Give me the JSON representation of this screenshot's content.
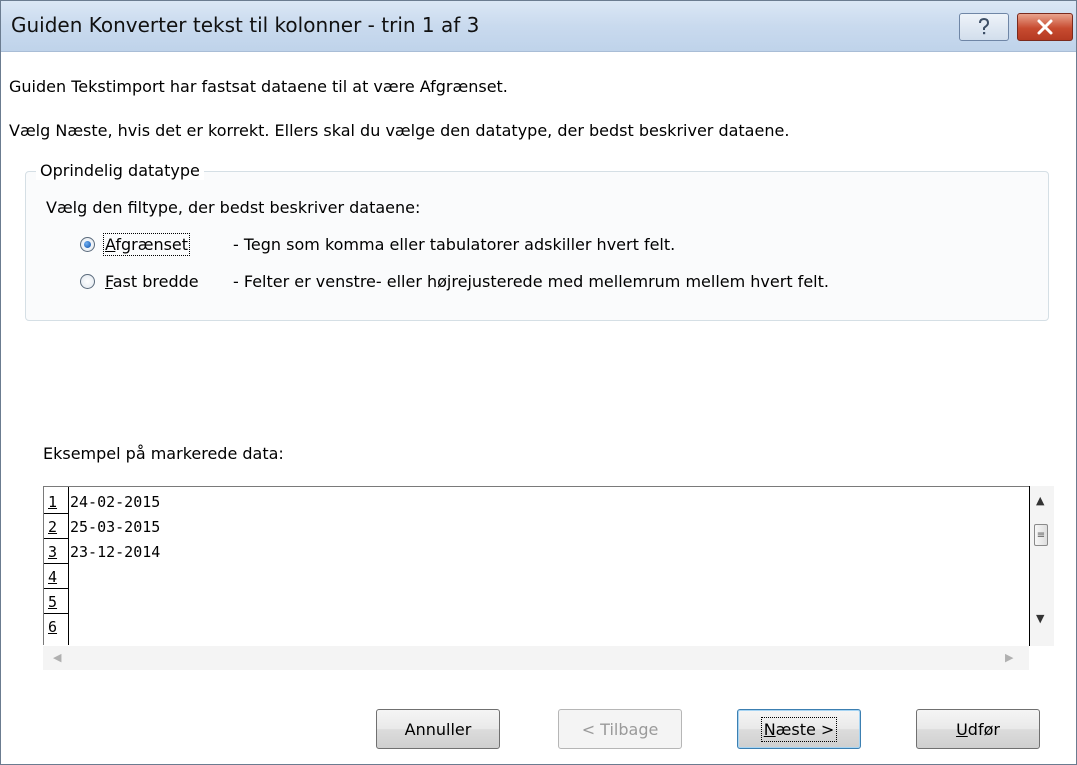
{
  "window": {
    "title": "Guiden Konverter tekst til kolonner - trin 1 af 3",
    "help_icon": "question-mark-icon",
    "close_icon": "close-x-icon"
  },
  "intro": {
    "line1": "Guiden Tekstimport har fastsat dataene til at være Afgrænset.",
    "line2": "Vælg Næste, hvis det er korrekt. Ellers skal du vælge den datatype, der bedst beskriver dataene."
  },
  "datatype_group": {
    "legend": "Oprindelig datatype",
    "prompt": "Vælg den filtype, der bedst beskriver dataene:",
    "options": [
      {
        "key": "A",
        "label_rest": "fgrænset",
        "description": "- Tegn som komma eller tabulatorer adskiller hvert felt.",
        "selected": true
      },
      {
        "key": "F",
        "label_rest": "ast bredde",
        "description": "- Felter er venstre- eller højrejusterede med mellemrum mellem hvert felt.",
        "selected": false
      }
    ]
  },
  "preview": {
    "label": "Eksempel på markerede data:",
    "line_numbers": [
      "1",
      "2",
      "3",
      "4",
      "5",
      "6"
    ],
    "lines": [
      "24-02-2015",
      "25-03-2015",
      "23-12-2014",
      "",
      "",
      ""
    ]
  },
  "buttons": {
    "cancel": "Annuller",
    "back": "< Tilbage",
    "next_key": "N",
    "next_rest": "æste >",
    "finish_key": "U",
    "finish_rest": "dfør"
  }
}
